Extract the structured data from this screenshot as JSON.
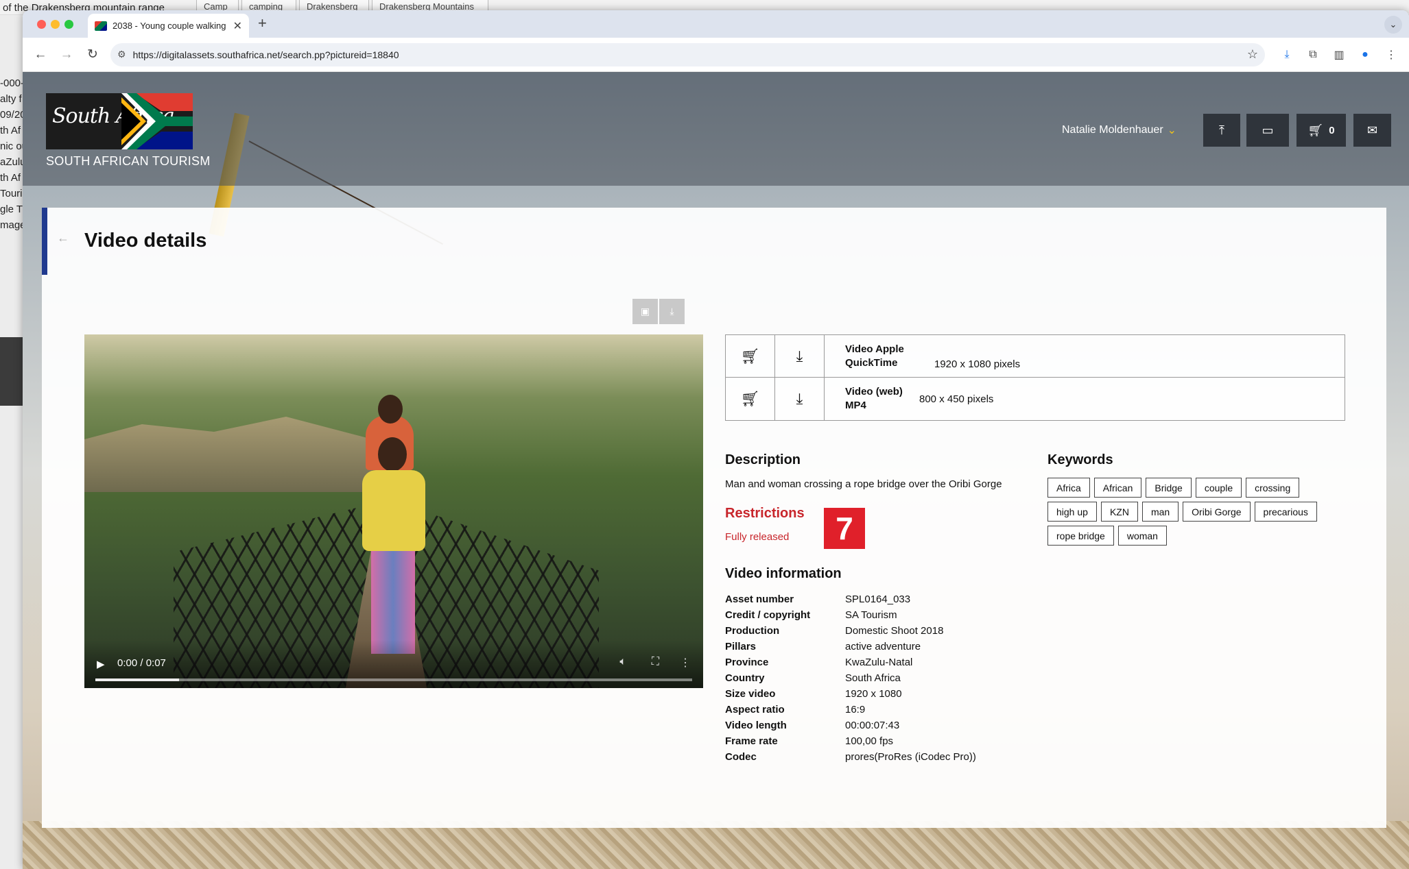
{
  "background_window": {
    "title_fragment": "of the Drakensberg mountain range",
    "tabs": [
      "Camp",
      "camping",
      "Drakensberg",
      "Drakensberg Mountains"
    ],
    "left_fragments": [
      "-000-",
      "alty f",
      "09/20",
      "th Af",
      "nic ou",
      "aZulu",
      "th Af",
      "Touris",
      "gle T",
      "mage"
    ]
  },
  "browser": {
    "tab_title": "2038 - Young couple walking",
    "url": "https://digitalassets.southafrica.net/search.pp?pictureid=18840",
    "traffic_lights": [
      "#ff5f57",
      "#febc2e",
      "#28c840"
    ]
  },
  "site": {
    "logo_script": "South Africa",
    "logo_caption": "SOUTH AFRICAN TOURISM",
    "user_name": "Natalie Moldenhauer",
    "cart_count": "0",
    "accent_color": "#203a8f"
  },
  "page": {
    "title": "Video details"
  },
  "video": {
    "time": "0:00 / 0:07",
    "progress_fraction": 0.14
  },
  "formats": [
    {
      "name": "Video Apple QuickTime",
      "dims": "1920 x 1080 pixels"
    },
    {
      "name": "Video (web) MP4",
      "dims": "800 x 450 pixels"
    }
  ],
  "description": {
    "heading": "Description",
    "text": "Man and woman crossing a rope bridge over the Oribi Gorge"
  },
  "restrictions": {
    "heading": "Restrictions",
    "status": "Fully released",
    "badge": "7",
    "color": "#c8252b"
  },
  "keywords": {
    "heading": "Keywords",
    "items": [
      "Africa",
      "African",
      "Bridge",
      "couple",
      "crossing",
      "high up",
      "KZN",
      "man",
      "Oribi Gorge",
      "precarious",
      "rope bridge",
      "woman"
    ]
  },
  "video_info": {
    "heading": "Video information",
    "rows": [
      {
        "key": "Asset number",
        "value": "SPL0164_033"
      },
      {
        "key": "Credit / copyright",
        "value": "SA Tourism"
      },
      {
        "key": "Production",
        "value": "Domestic Shoot 2018"
      },
      {
        "key": "Pillars",
        "value": "active adventure"
      },
      {
        "key": "Province",
        "value": "KwaZulu-Natal"
      },
      {
        "key": "Country",
        "value": "South Africa"
      },
      {
        "key": "Size video",
        "value": "1920 x 1080"
      },
      {
        "key": "Aspect ratio",
        "value": "16:9"
      },
      {
        "key": "Video length",
        "value": "00:00:07:43"
      },
      {
        "key": "Frame rate",
        "value": "100,00 fps"
      },
      {
        "key": "Codec",
        "value": "prores(ProRes (iCodec Pro))"
      }
    ]
  }
}
